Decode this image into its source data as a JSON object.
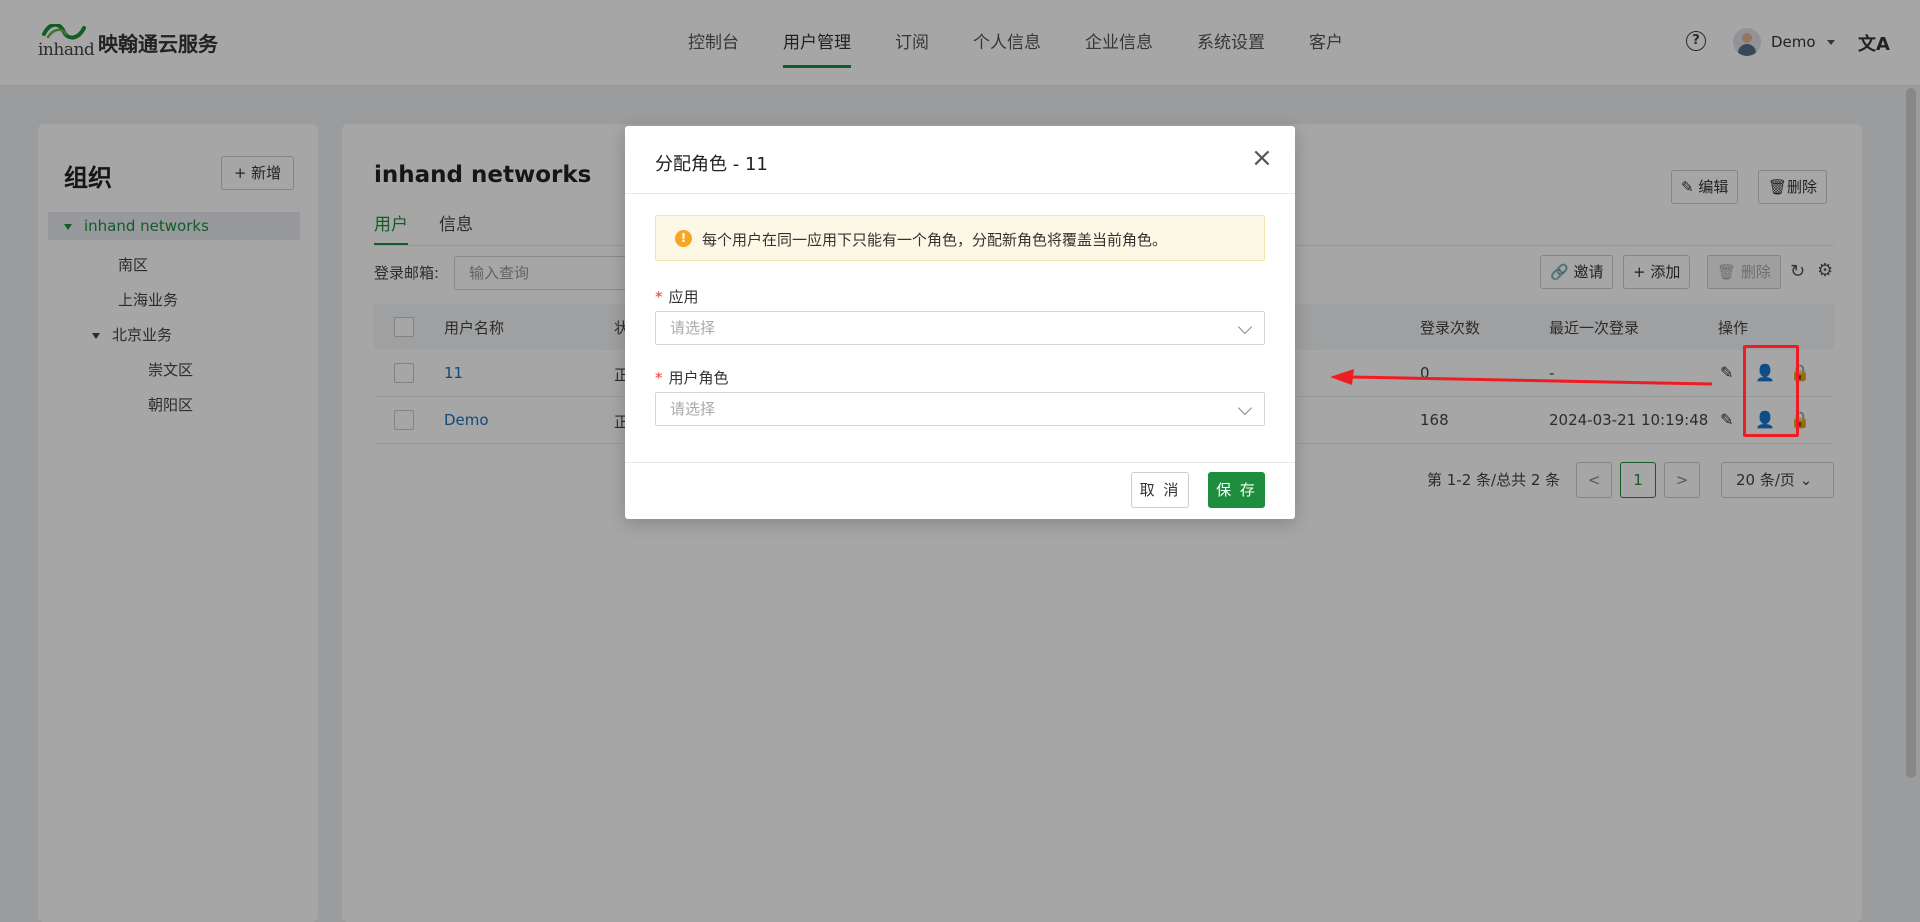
{
  "header": {
    "brand_name": "映翰通云服务",
    "logo_word": "inhand",
    "nav": [
      "控制台",
      "用户管理",
      "订阅",
      "个人信息",
      "企业信息",
      "系统设置",
      "客户"
    ],
    "active_nav": "用户管理",
    "user_name": "Demo",
    "icons": [
      "help-icon",
      "avatar",
      "translate-icon"
    ]
  },
  "sidebar": {
    "title": "组织",
    "add_label": "+ 新增",
    "tree": [
      {
        "label": "inhand networks",
        "selected": true
      },
      {
        "label": "南区"
      },
      {
        "label": "上海业务"
      },
      {
        "label": "北京业务"
      },
      {
        "label": "崇文区"
      },
      {
        "label": "朝阳区"
      }
    ]
  },
  "main": {
    "title": "inhand networks",
    "edit_label": "编辑",
    "delete_label": "删除",
    "tabs": [
      "用户",
      "信息"
    ],
    "filter_label": "登录邮箱:",
    "filter_placeholder": "输入查询",
    "toolbar": {
      "invite": "邀请",
      "add": "添加",
      "remove": "删除"
    },
    "table": {
      "headers": [
        "用户名称",
        "状",
        "登录次数",
        "最近一次登录",
        "操作"
      ],
      "rows": [
        {
          "name": "11",
          "status": "正",
          "logins": "0",
          "last_login": "-"
        },
        {
          "name": "Demo",
          "status": "正",
          "logins": "168",
          "last_login": "2024-03-21 10:19:48"
        }
      ]
    },
    "pager": {
      "summary": "第 1-2 条/总共 2 条",
      "prev": "<",
      "current": "1",
      "next": ">",
      "page_size": "20 条/页"
    }
  },
  "modal": {
    "title": "分配角色 - 11",
    "close": "×",
    "alert": "每个用户在同一应用下只能有一个角色，分配新角色将覆盖当前角色。",
    "app_label": "应用",
    "app_placeholder": "请选择",
    "role_label": "用户角色",
    "role_placeholder": "请选择",
    "cancel": "取 消",
    "save": "保 存"
  },
  "annotation": {
    "color": "#ee1d23"
  }
}
